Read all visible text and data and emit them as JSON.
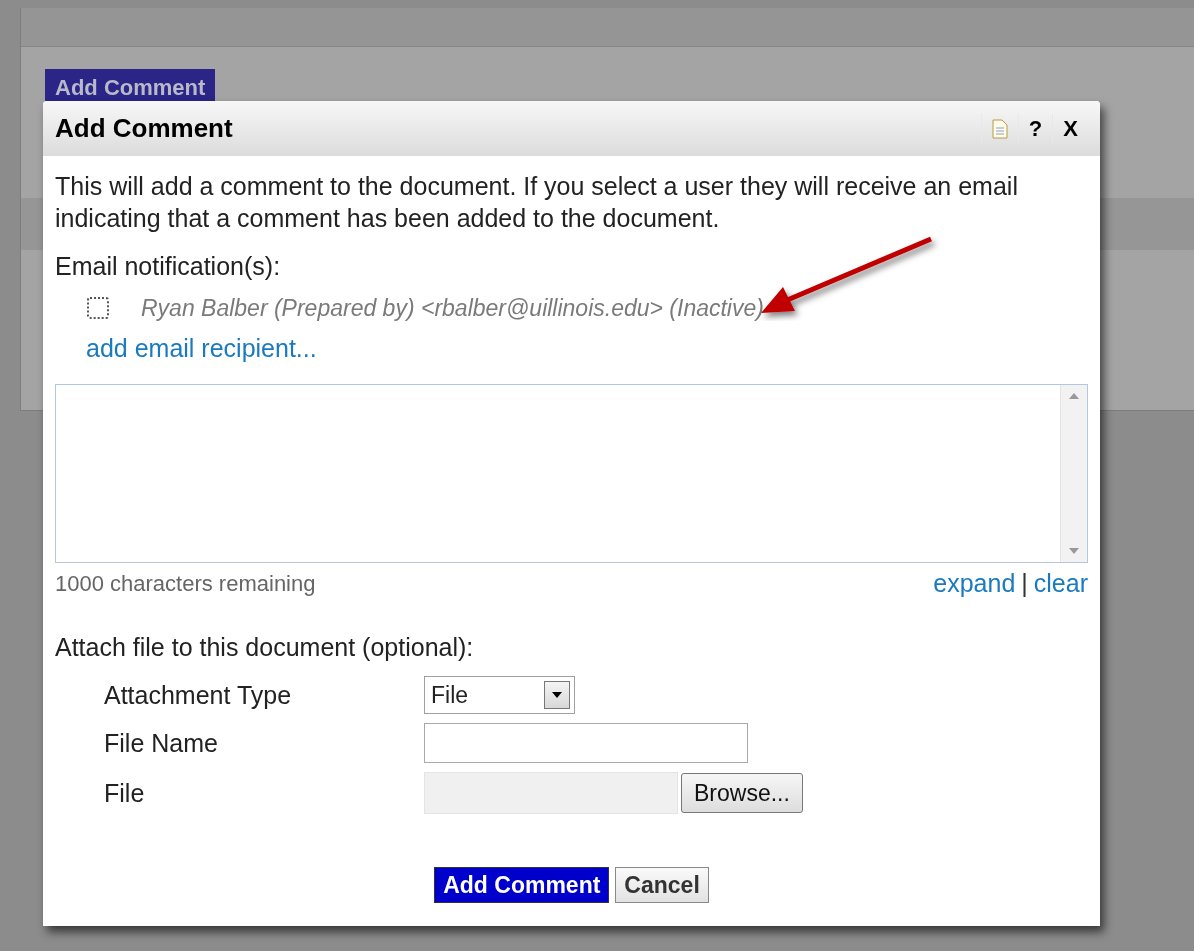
{
  "background": {
    "button": "Add Comment"
  },
  "dialog": {
    "title": "Add Comment",
    "help": "?",
    "close": "X"
  },
  "intro": "This will add a comment to the document. If you select a user they will receive an email indicating that a comment has been added to the document.",
  "notifications": {
    "label": "Email notification(s):",
    "recipients": [
      {
        "name": "Ryan Balber (Prepared by) <rbalber@uillinois.edu> (Inactive)",
        "checked": false,
        "inactive": true
      }
    ],
    "add_link": "add email recipient..."
  },
  "comment": {
    "remaining": "1000 characters remaining",
    "links": [
      "expand",
      "clear"
    ],
    "separator": "|"
  },
  "attach": {
    "heading": "Attach file to this document (optional):",
    "fields": [
      {
        "label": "Attachment Type",
        "kind": "select",
        "value": "File"
      },
      {
        "label": "File Name",
        "kind": "text"
      },
      {
        "label": "File",
        "kind": "file",
        "button": "Browse..."
      }
    ]
  },
  "buttons": [
    {
      "label": "Add Comment",
      "kind": "primary"
    },
    {
      "label": "Cancel",
      "kind": "secondary"
    }
  ]
}
